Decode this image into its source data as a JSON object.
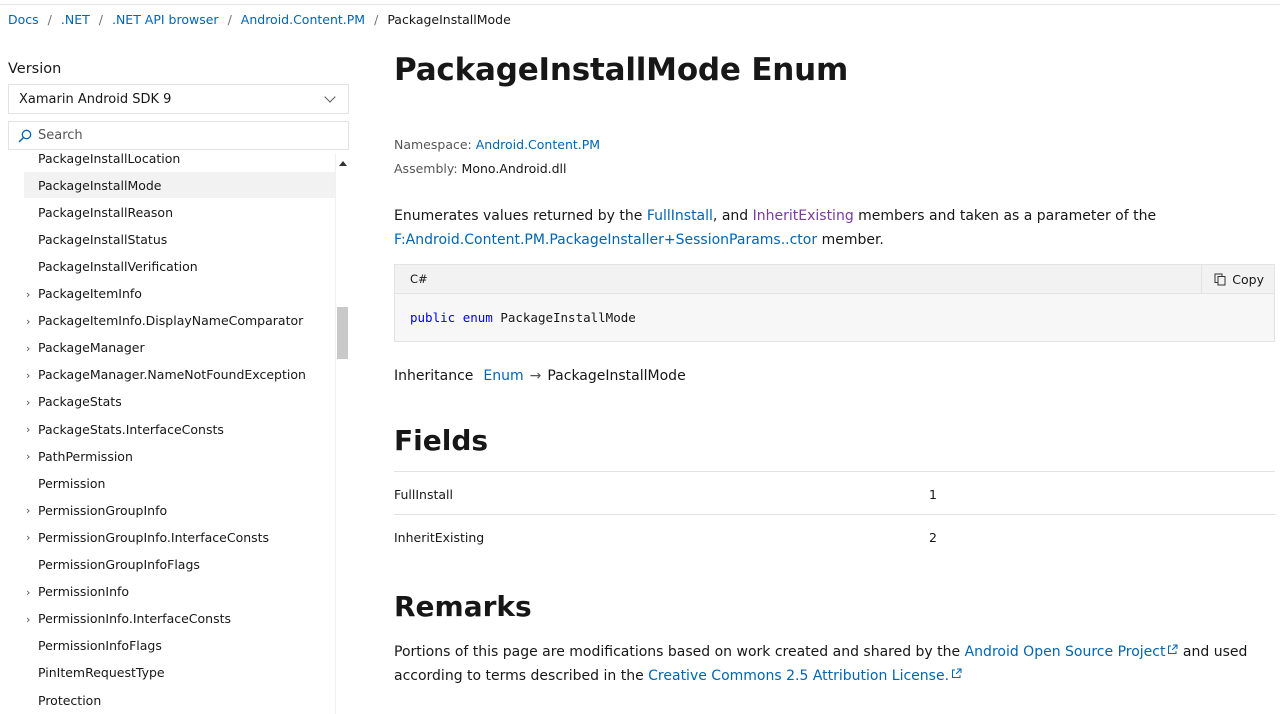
{
  "breadcrumb": {
    "items": [
      "Docs",
      ".NET",
      ".NET API browser",
      "Android.Content.PM"
    ],
    "current": "PackageInstallMode",
    "separator": "/"
  },
  "sidebar": {
    "version_label": "Version",
    "version_value": "Xamarin Android SDK 9",
    "search_placeholder": "Search",
    "toc": [
      {
        "label": "PackageInstallLocation",
        "expandable": false,
        "selected": false
      },
      {
        "label": "PackageInstallMode",
        "expandable": false,
        "selected": true
      },
      {
        "label": "PackageInstallReason",
        "expandable": false,
        "selected": false
      },
      {
        "label": "PackageInstallStatus",
        "expandable": false,
        "selected": false
      },
      {
        "label": "PackageInstallVerification",
        "expandable": false,
        "selected": false
      },
      {
        "label": "PackageItemInfo",
        "expandable": true,
        "selected": false
      },
      {
        "label": "PackageItemInfo.DisplayNameComparator",
        "expandable": true,
        "selected": false
      },
      {
        "label": "PackageManager",
        "expandable": true,
        "selected": false
      },
      {
        "label": "PackageManager.NameNotFoundException",
        "expandable": true,
        "selected": false
      },
      {
        "label": "PackageStats",
        "expandable": true,
        "selected": false
      },
      {
        "label": "PackageStats.InterfaceConsts",
        "expandable": true,
        "selected": false
      },
      {
        "label": "PathPermission",
        "expandable": true,
        "selected": false
      },
      {
        "label": "Permission",
        "expandable": false,
        "selected": false
      },
      {
        "label": "PermissionGroupInfo",
        "expandable": true,
        "selected": false
      },
      {
        "label": "PermissionGroupInfo.InterfaceConsts",
        "expandable": true,
        "selected": false
      },
      {
        "label": "PermissionGroupInfoFlags",
        "expandable": false,
        "selected": false
      },
      {
        "label": "PermissionInfo",
        "expandable": true,
        "selected": false
      },
      {
        "label": "PermissionInfo.InterfaceConsts",
        "expandable": true,
        "selected": false
      },
      {
        "label": "PermissionInfoFlags",
        "expandable": false,
        "selected": false
      },
      {
        "label": "PinItemRequestType",
        "expandable": false,
        "selected": false
      },
      {
        "label": "Protection",
        "expandable": false,
        "selected": false
      }
    ]
  },
  "main": {
    "title": "PackageInstallMode Enum",
    "namespace_label": "Namespace:",
    "namespace_value": "Android.Content.PM",
    "assembly_label": "Assembly:",
    "assembly_value": "Mono.Android.dll",
    "summary": {
      "part1": "Enumerates values returned by the ",
      "link1": "FullInstall",
      "part2": ", and ",
      "link2": "InheritExisting",
      "part3": " members and taken as a parameter of the ",
      "link3": "F:Android.Content.PM.PackageInstaller+SessionParams..ctor",
      "part4": " member."
    },
    "code": {
      "language": "C#",
      "copy_label": "Copy",
      "kw1": "public",
      "kw2": "enum",
      "name": "PackageInstallMode"
    },
    "inheritance": {
      "label": "Inheritance",
      "base": "Enum",
      "arrow": "→",
      "current": "PackageInstallMode"
    },
    "fields_heading": "Fields",
    "fields": [
      {
        "name": "FullInstall",
        "value": "1"
      },
      {
        "name": "InheritExisting",
        "value": "2"
      }
    ],
    "remarks_heading": "Remarks",
    "remarks": {
      "part1": "Portions of this page are modifications based on work created and shared by the ",
      "link1": "Android Open Source Project",
      "part2": " and used according to terms described in the ",
      "link2": "Creative Commons 2.5 Attribution License.",
      "part3": ""
    }
  },
  "colors": {
    "link": "#0065b3",
    "visited_link": "#7a3a9e",
    "selected_bg": "#f2f2f2",
    "keyword": "#0101fd"
  }
}
